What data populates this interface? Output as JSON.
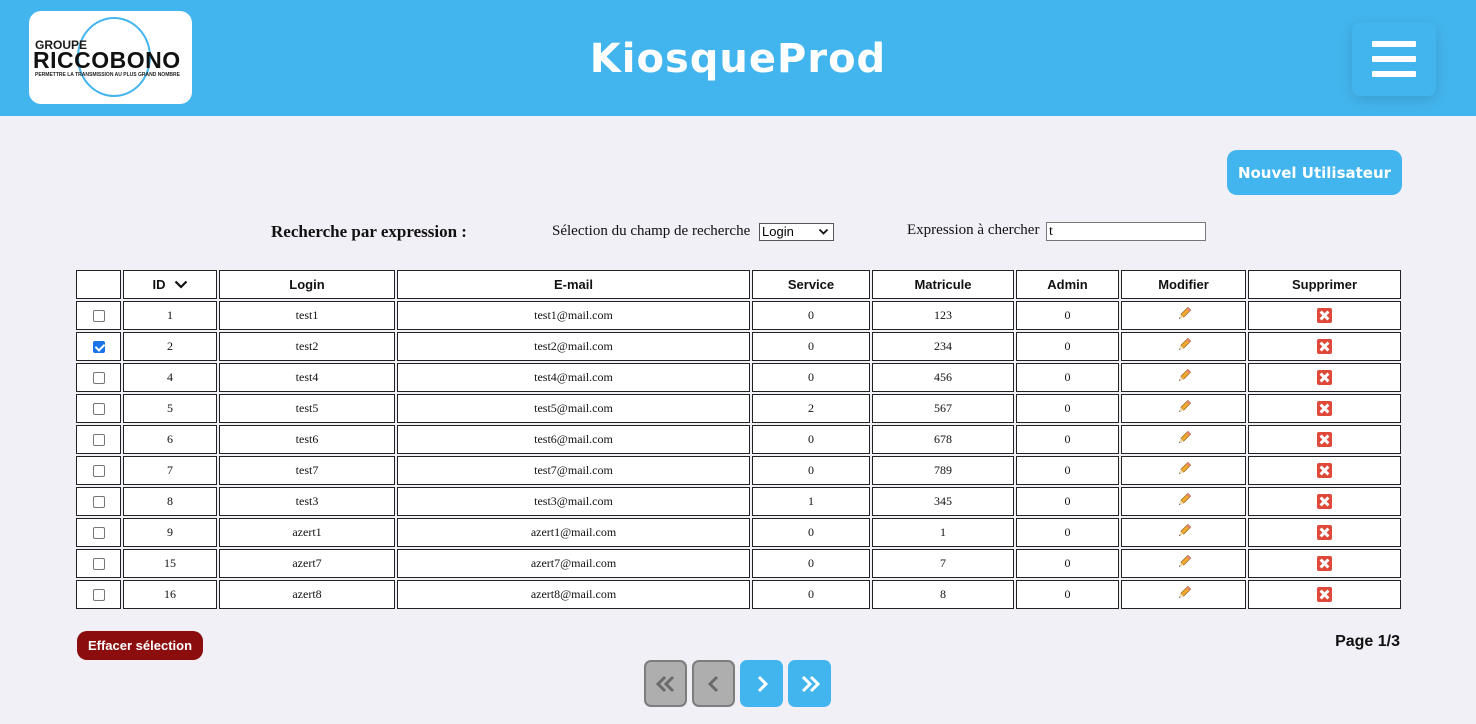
{
  "header": {
    "logo": {
      "groupe": "GROUPE",
      "name": "RICCOBONO",
      "tagline": "PERMETTRE LA TRANSMISSION AU PLUS GRAND NOMBRE"
    },
    "title": "KiosqueProd",
    "menu_icon": "hamburger-menu-icon"
  },
  "actions": {
    "new_user_label": "Nouvel Utilisateur"
  },
  "search": {
    "title": "Recherche par expression :",
    "field_label": "Sélection du champ de recherche",
    "field_value": "Login",
    "expression_label": "Expression à chercher",
    "expression_value": "t"
  },
  "table": {
    "headers": {
      "id": "ID",
      "login": "Login",
      "email": "E-mail",
      "service": "Service",
      "matricule": "Matricule",
      "admin": "Admin",
      "edit": "Modifier",
      "delete": "Supprimer"
    },
    "sort": {
      "column": "ID",
      "icon": "chevron-down-icon"
    },
    "rows": [
      {
        "checked": false,
        "id": "1",
        "login": "test1",
        "email": "test1@mail.com",
        "service": "0",
        "matricule": "123",
        "admin": "0"
      },
      {
        "checked": true,
        "id": "2",
        "login": "test2",
        "email": "test2@mail.com",
        "service": "0",
        "matricule": "234",
        "admin": "0"
      },
      {
        "checked": false,
        "id": "4",
        "login": "test4",
        "email": "test4@mail.com",
        "service": "0",
        "matricule": "456",
        "admin": "0"
      },
      {
        "checked": false,
        "id": "5",
        "login": "test5",
        "email": "test5@mail.com",
        "service": "2",
        "matricule": "567",
        "admin": "0"
      },
      {
        "checked": false,
        "id": "6",
        "login": "test6",
        "email": "test6@mail.com",
        "service": "0",
        "matricule": "678",
        "admin": "0"
      },
      {
        "checked": false,
        "id": "7",
        "login": "test7",
        "email": "test7@mail.com",
        "service": "0",
        "matricule": "789",
        "admin": "0"
      },
      {
        "checked": false,
        "id": "8",
        "login": "test3",
        "email": "test3@mail.com",
        "service": "1",
        "matricule": "345",
        "admin": "0"
      },
      {
        "checked": false,
        "id": "9",
        "login": "azert1",
        "email": "azert1@mail.com",
        "service": "0",
        "matricule": "1",
        "admin": "0"
      },
      {
        "checked": false,
        "id": "15",
        "login": "azert7",
        "email": "azert7@mail.com",
        "service": "0",
        "matricule": "7",
        "admin": "0"
      },
      {
        "checked": false,
        "id": "16",
        "login": "azert8",
        "email": "azert8@mail.com",
        "service": "0",
        "matricule": "8",
        "admin": "0"
      }
    ],
    "edit_icon": "pencil-icon",
    "delete_icon": "delete-x-icon"
  },
  "footer": {
    "clear_selection_label": "Effacer sélection",
    "page_indicator": "Page 1/3"
  },
  "pagination": {
    "first": {
      "icon": "double-chevron-left-icon",
      "enabled": false
    },
    "prev": {
      "icon": "chevron-left-icon",
      "enabled": false
    },
    "next": {
      "icon": "chevron-right-icon",
      "enabled": true
    },
    "last": {
      "icon": "double-chevron-right-icon",
      "enabled": true
    }
  },
  "colors": {
    "primary": "#43b5ee",
    "background": "#f0f0f6",
    "danger": "#8b0d0d",
    "delete_icon": "#e0483a",
    "disabled": "#aeaeae"
  }
}
